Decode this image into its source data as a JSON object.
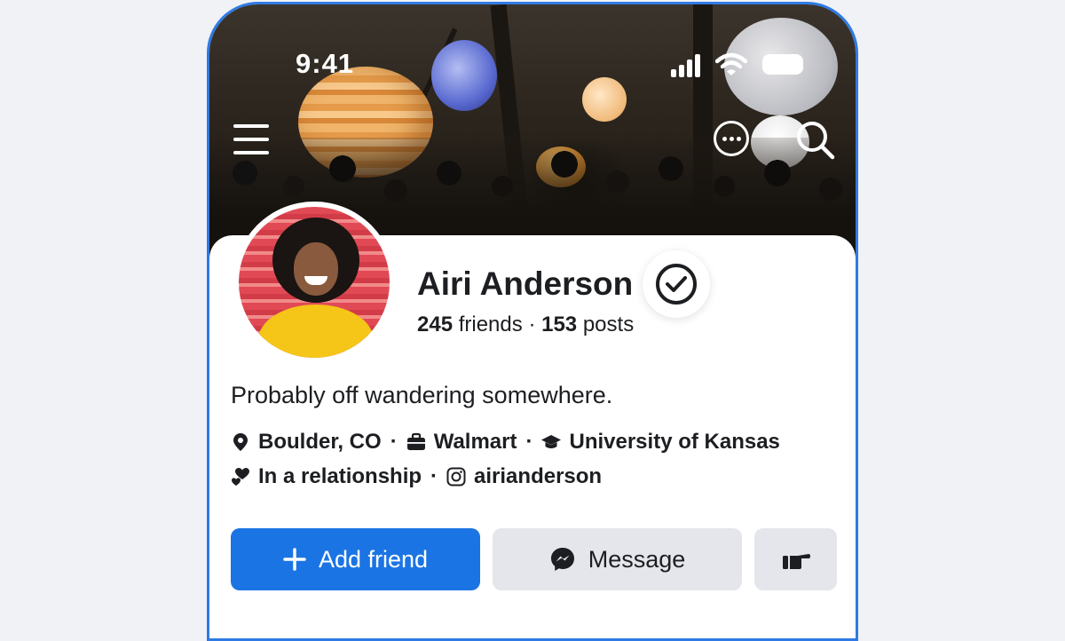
{
  "status_bar": {
    "time": "9:41"
  },
  "profile": {
    "name": "Airi Anderson",
    "friends_count": "245",
    "friends_label": "friends",
    "separator": "·",
    "posts_count": "153",
    "posts_label": "posts",
    "bio": "Probably off wandering somewhere.",
    "location": "Boulder, CO",
    "work": "Walmart",
    "education": "University of Kansas",
    "relationship": "In a relationship",
    "instagram": "airianderson"
  },
  "actions": {
    "add_friend": "Add friend",
    "message": "Message"
  },
  "colors": {
    "primary": "#1b74e4",
    "secondary_button": "#e4e6eb",
    "frame": "#2f7ae5",
    "background": "#f0f2f5"
  },
  "icons": {
    "menu": "menu-icon",
    "more": "more-icon",
    "search": "search-icon",
    "verified": "verified-badge-icon",
    "location": "location-pin-icon",
    "work": "briefcase-icon",
    "education": "graduation-cap-icon",
    "relationship": "hearts-icon",
    "instagram": "instagram-icon",
    "add": "plus-icon",
    "messenger": "messenger-icon",
    "poke": "poke-hand-icon"
  }
}
